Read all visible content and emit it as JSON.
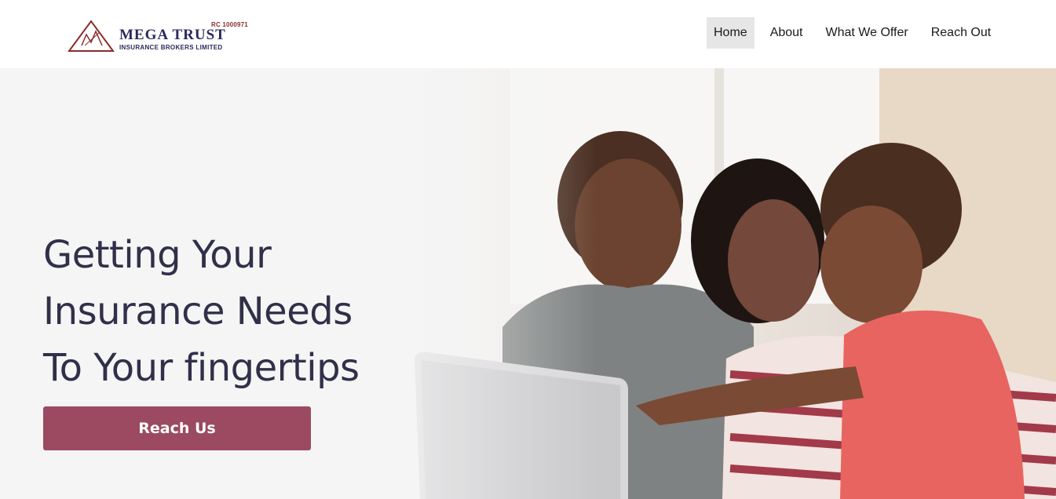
{
  "header": {
    "logo": {
      "rc_number": "RC 1000971",
      "brand": "MEGA TRUST",
      "tagline": "INSURANCE BROKERS LIMITED"
    },
    "nav": [
      {
        "label": "Home",
        "active": true
      },
      {
        "label": "About",
        "active": false
      },
      {
        "label": "What We Offer",
        "active": false
      },
      {
        "label": "Reach Out",
        "active": false
      }
    ]
  },
  "hero": {
    "headline_lines": [
      "Getting Your",
      "Insurance Needs",
      "To Your fingertips"
    ],
    "cta_label": "Reach Us",
    "image": "family-using-laptop-photo"
  },
  "colors": {
    "brand_navy": "#2a2a5e",
    "brand_maroon": "#8a2d2d",
    "cta": "#9b4a61",
    "headline": "#31304a",
    "nav_active_bg": "#e6e6e6"
  }
}
